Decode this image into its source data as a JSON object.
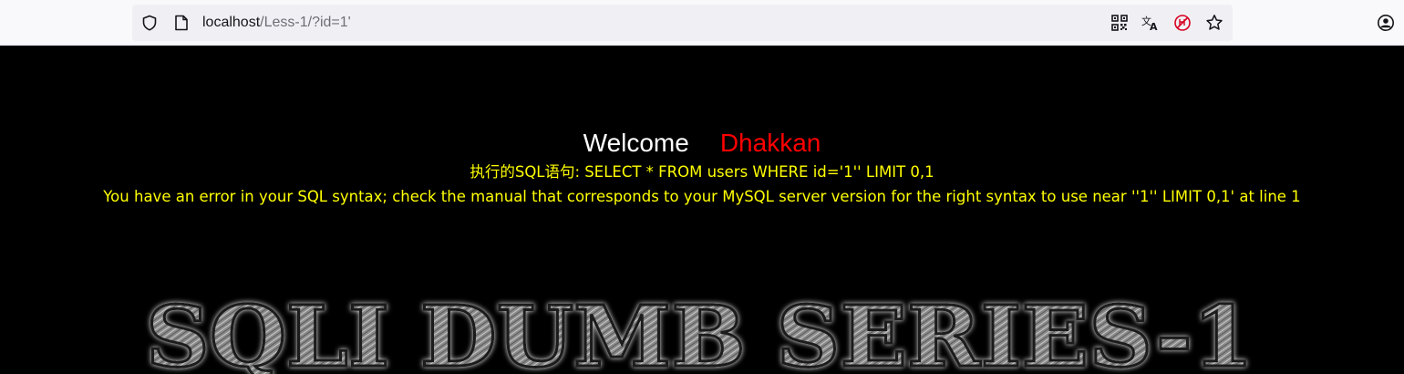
{
  "browser": {
    "url_host": "localhost",
    "url_path": "/Less-1/?id=1'",
    "icons": [
      "tracking-shield-icon",
      "page-info-icon",
      "qr-code-icon",
      "translate-icon",
      "blocked-extension-icon",
      "bookmark-star-icon",
      "account-icon"
    ]
  },
  "page": {
    "welcome": "Welcome",
    "username": "Dhakkan",
    "sql_statement": "执行的SQL语句: SELECT * FROM users WHERE id='1'' LIMIT 0,1",
    "error_message": "You have an error in your SQL syntax; check the manual that corresponds to your MySQL server version for the right syntax to use near ''1'' LIMIT 0,1' at line 1",
    "logo_text": "SQLI DUMB SERIES-1"
  },
  "colors": {
    "background": "#000000",
    "welcome": "#ffffff",
    "username": "#ff0000",
    "message": "#ffff00"
  }
}
